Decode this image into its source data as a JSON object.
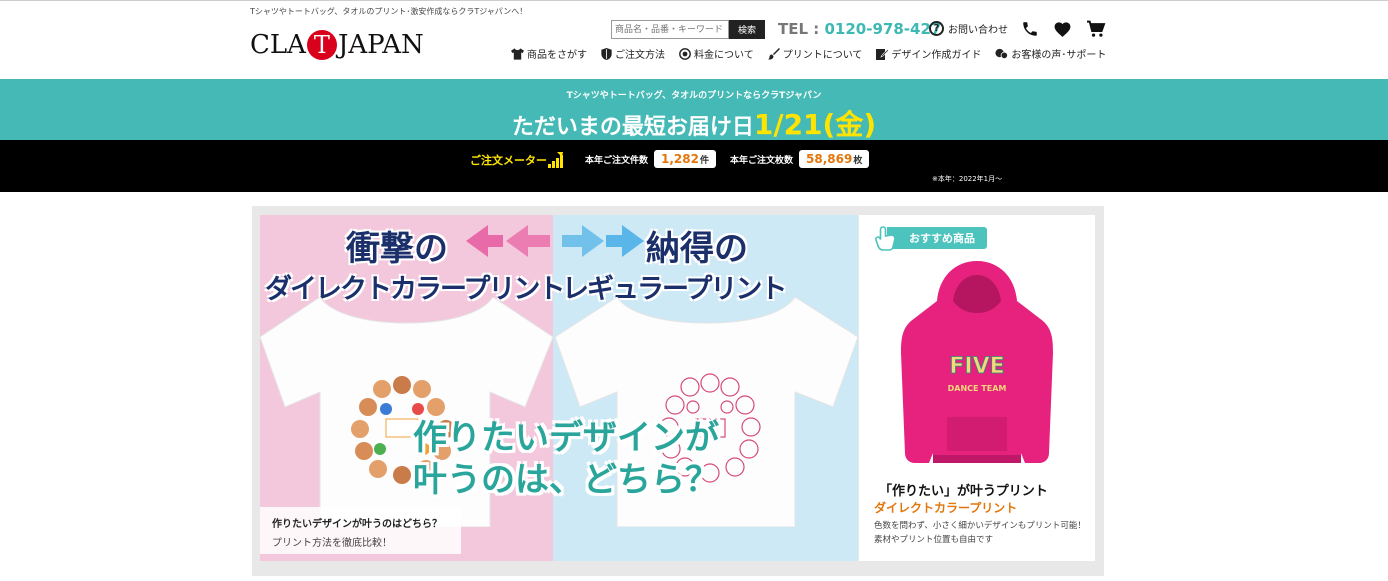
{
  "header": {
    "tagline": "Tシャツやトートバッグ、タオルのプリント･激安作成ならクラTジャパンへ！",
    "logo_left": "CLA",
    "logo_t": "T",
    "logo_right": "JAPAN",
    "search_placeholder": "商品名・品番・キーワード",
    "search_button": "検索",
    "tel_label": "TEL :",
    "tel_number": "0120-978-427",
    "contact_label": "お問い合わせ",
    "icons": [
      "phone-icon",
      "heart-icon",
      "cart-icon"
    ]
  },
  "nav": [
    {
      "label": "商品をさがす",
      "icon": "tshirt-icon"
    },
    {
      "label": "ご注文方法",
      "icon": "shield-icon"
    },
    {
      "label": "料金について",
      "icon": "coin-icon"
    },
    {
      "label": "プリントについて",
      "icon": "brush-icon"
    },
    {
      "label": "デザイン作成ガイド",
      "icon": "edit-icon"
    },
    {
      "label": "お客様の声･サポート",
      "icon": "chat-icon"
    }
  ],
  "banner": {
    "small": "Tシャツやトートバッグ、タオルのプリントならクラTジャパン",
    "lead": "ただいまの最短お届け日",
    "date": "1/21(金)",
    "accent": "#45b9b5"
  },
  "meter": {
    "title": "ご注文メーター",
    "orders_label": "本年ご注文件数",
    "orders_value": "1,282",
    "orders_unit": "件",
    "items_label": "本年ご注文枚数",
    "items_value": "58,869",
    "items_unit": "枚",
    "since": "※本年：2022年1月～"
  },
  "hero": {
    "left_line1": "衝撃の",
    "left_line2": "ダイレクトカラープリント",
    "right_line1": "納得の",
    "right_line2": "レギュラープリント",
    "question_line1": "作りたいデザインが",
    "question_line2": "叶うのは、どちら？",
    "caption_title": "作りたいデザインが叶うのはどちら？",
    "caption_sub": "プリント方法を徹底比較！"
  },
  "side": {
    "badge": "おすすめ商品",
    "hoodie_text": "FIVE",
    "hoodie_subtext": "DANCE TEAM",
    "title": "「作りたい」が叶うプリント",
    "subtitle": "ダイレクトカラープリント",
    "desc": "色数を問わず、小さく細かいデザインもプリント可能！素材やプリント位置も自由です"
  }
}
